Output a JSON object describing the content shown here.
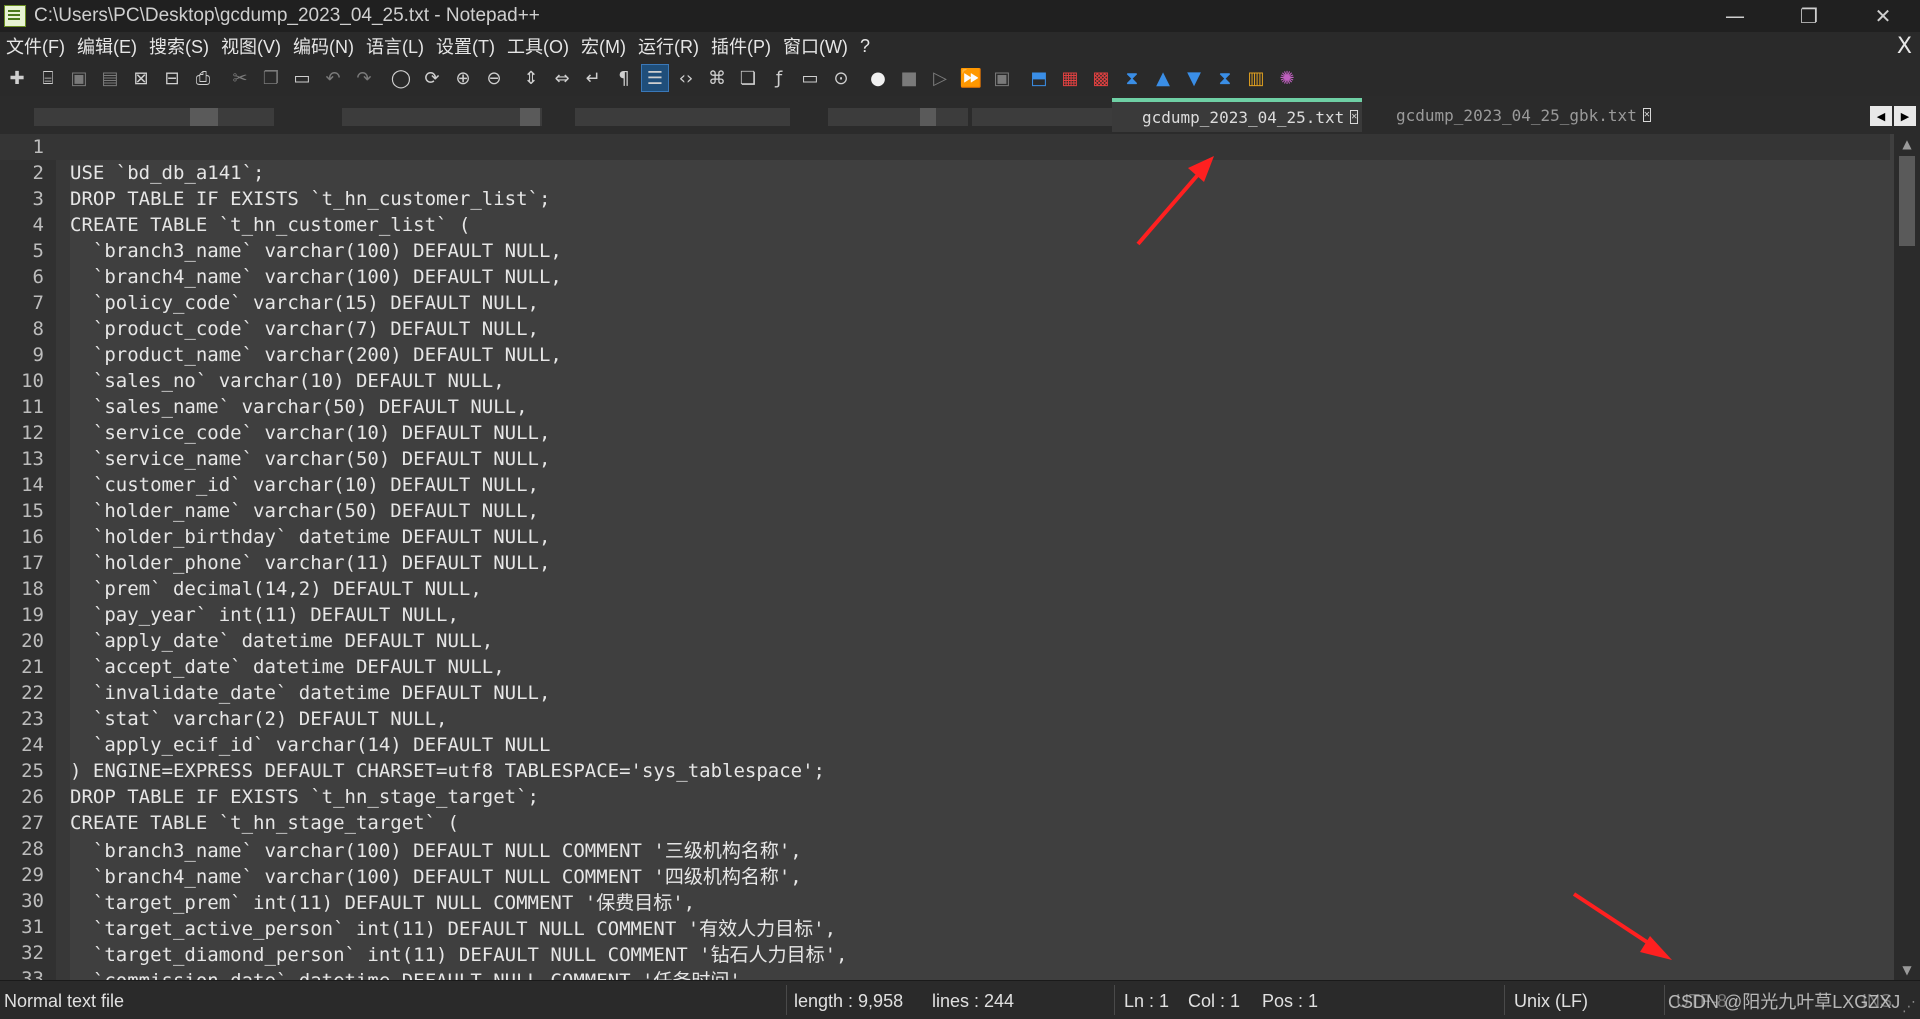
{
  "window": {
    "title": "C:\\Users\\PC\\Desktop\\gcdump_2023_04_25.txt - Notepad++",
    "minimize": "—",
    "restore": "❐",
    "close": "✕"
  },
  "menu": {
    "items": [
      "文件(F)",
      "编辑(E)",
      "搜索(S)",
      "视图(V)",
      "编码(N)",
      "语言(L)",
      "设置(T)",
      "工具(O)",
      "宏(M)",
      "运行(R)",
      "插件(P)",
      "窗口(W)",
      "?"
    ],
    "close": "X"
  },
  "toolbar": {
    "icons": [
      "new-file-icon",
      "open-file-icon",
      "save-icon",
      "save-all-icon",
      "close-icon",
      "close-all-icon",
      "print-icon",
      "cut-icon",
      "copy-icon",
      "paste-icon",
      "undo-icon",
      "redo-icon",
      "find-icon",
      "replace-icon",
      "zoom-in-icon",
      "zoom-out-icon",
      "sync-vertical-icon",
      "sync-horizontal-icon",
      "word-wrap-icon",
      "show-all-chars-icon",
      "indent-guide-icon",
      "language-markup-icon",
      "document-map-icon",
      "function-list-icon",
      "folder-as-workspace-icon",
      "function-icon",
      "monitor-icon",
      "record-macro-icon",
      "stop-record-icon",
      "play-macro-icon",
      "run-multiple-macro-icon",
      "save-macro-icon",
      "compare-icon",
      "compare-diff-icon",
      "compare-clear-icon",
      "compare-first-icon",
      "compare-prev-icon",
      "compare-next-icon",
      "compare-last-icon",
      "compare-panel-icon",
      "color-icon"
    ],
    "active": "indent-guide-icon"
  },
  "tabs": [
    {
      "label": "gcdump_2023_04_25.txt",
      "active": true
    },
    {
      "label": "gcdump_2023_04_25_gbk.txt",
      "active": false
    }
  ],
  "editor": {
    "lines": [
      {
        "n": "1",
        "t": ""
      },
      {
        "n": "2",
        "t": "USE `bd_db_a141`;"
      },
      {
        "n": "3",
        "t": "DROP TABLE IF EXISTS `t_hn_customer_list`;"
      },
      {
        "n": "4",
        "t": "CREATE TABLE `t_hn_customer_list` ("
      },
      {
        "n": "5",
        "t": "  `branch3_name` varchar(100) DEFAULT NULL,"
      },
      {
        "n": "6",
        "t": "  `branch4_name` varchar(100) DEFAULT NULL,"
      },
      {
        "n": "7",
        "t": "  `policy_code` varchar(15) DEFAULT NULL,"
      },
      {
        "n": "8",
        "t": "  `product_code` varchar(7) DEFAULT NULL,"
      },
      {
        "n": "9",
        "t": "  `product_name` varchar(200) DEFAULT NULL,"
      },
      {
        "n": "10",
        "t": "  `sales_no` varchar(10) DEFAULT NULL,"
      },
      {
        "n": "11",
        "t": "  `sales_name` varchar(50) DEFAULT NULL,"
      },
      {
        "n": "12",
        "t": "  `service_code` varchar(10) DEFAULT NULL,"
      },
      {
        "n": "13",
        "t": "  `service_name` varchar(50) DEFAULT NULL,"
      },
      {
        "n": "14",
        "t": "  `customer_id` varchar(10) DEFAULT NULL,"
      },
      {
        "n": "15",
        "t": "  `holder_name` varchar(50) DEFAULT NULL,"
      },
      {
        "n": "16",
        "t": "  `holder_birthday` datetime DEFAULT NULL,"
      },
      {
        "n": "17",
        "t": "  `holder_phone` varchar(11) DEFAULT NULL,"
      },
      {
        "n": "18",
        "t": "  `prem` decimal(14,2) DEFAULT NULL,"
      },
      {
        "n": "19",
        "t": "  `pay_year` int(11) DEFAULT NULL,"
      },
      {
        "n": "20",
        "t": "  `apply_date` datetime DEFAULT NULL,"
      },
      {
        "n": "21",
        "t": "  `accept_date` datetime DEFAULT NULL,"
      },
      {
        "n": "22",
        "t": "  `invalidate_date` datetime DEFAULT NULL,"
      },
      {
        "n": "23",
        "t": "  `stat` varchar(2) DEFAULT NULL,"
      },
      {
        "n": "24",
        "t": "  `apply_ecif_id` varchar(14) DEFAULT NULL"
      },
      {
        "n": "25",
        "t": ") ENGINE=EXPRESS DEFAULT CHARSET=utf8 TABLESPACE='sys_tablespace';"
      },
      {
        "n": "26",
        "t": "DROP TABLE IF EXISTS `t_hn_stage_target`;"
      },
      {
        "n": "27",
        "t": "CREATE TABLE `t_hn_stage_target` ("
      },
      {
        "n": "28",
        "t": "  `branch3_name` varchar(100) DEFAULT NULL COMMENT '三级机构名称',"
      },
      {
        "n": "29",
        "t": "  `branch4_name` varchar(100) DEFAULT NULL COMMENT '四级机构名称',"
      },
      {
        "n": "30",
        "t": "  `target_prem` int(11) DEFAULT NULL COMMENT '保费目标',"
      },
      {
        "n": "31",
        "t": "  `target_active_person` int(11) DEFAULT NULL COMMENT '有效人力目标',"
      },
      {
        "n": "32",
        "t": "  `target_diamond_person` int(11) DEFAULT NULL COMMENT '钻石人力目标',"
      },
      {
        "n": "33",
        "t": "  `commission_date` datetime DEFAULT NULL COMMENT '任务时间',"
      }
    ]
  },
  "status": {
    "file_type": "Normal text file",
    "length": "length : 9,958",
    "lines": "lines : 244",
    "ln": "Ln : 1",
    "col": "Col : 1",
    "pos": "Pos : 1",
    "eol": "Unix (LF)",
    "encoding": "UTF-8",
    "mode": "INS",
    "watermark": "CSDN @阳光九叶草LXGZXJ"
  },
  "colors": {
    "editor_bg": "#3f3f3f",
    "active_tab_accent": "#6fd0a5",
    "annotation_arrow": "#ff2020"
  }
}
